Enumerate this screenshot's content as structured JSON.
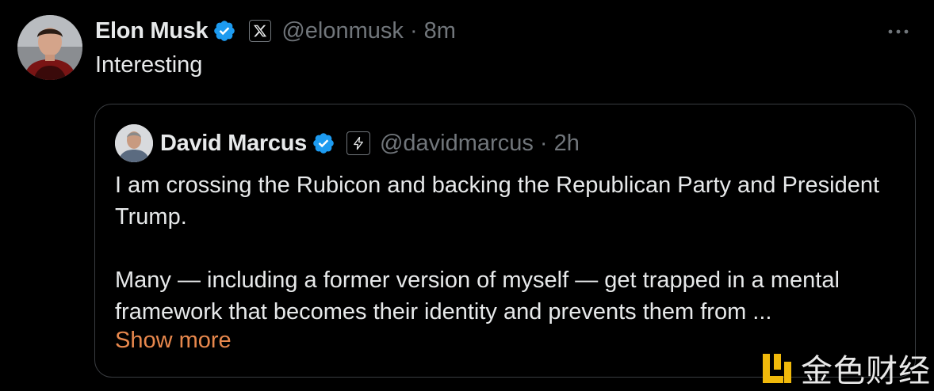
{
  "post": {
    "author": {
      "display_name": "Elon Musk",
      "handle_time": "@elonmusk · 8m",
      "verified": true,
      "affiliation_icon": "x-logo-icon"
    },
    "text": "Interesting",
    "more_icon": "more-horizontal-icon"
  },
  "quote": {
    "author": {
      "display_name": "David Marcus",
      "handle_time": "@davidmarcus · 2h",
      "verified": true,
      "affiliation_icon": "lightning-icon"
    },
    "paragraphs": [
      "I am crossing the Rubicon and backing the Republican Party and President Trump.",
      "Many — including a former version of myself — get trapped in a mental framework that becomes their identity and prevents them from ..."
    ],
    "show_more_label": "Show more"
  },
  "watermark": {
    "text": "金色财经"
  },
  "colors": {
    "background": "#000000",
    "primary_text": "#e7e9ea",
    "secondary_text": "#71767b",
    "verified_blue": "#1d9bf0",
    "card_border": "#3a3d41",
    "show_more": "#e8884d",
    "watermark_gold": "#f0b90b"
  }
}
